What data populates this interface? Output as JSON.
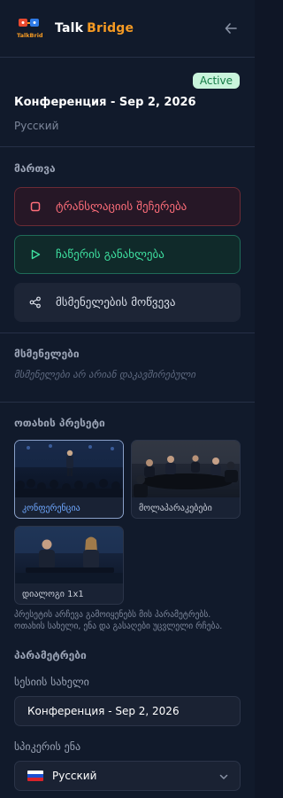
{
  "app": {
    "brand_part1": "Talk",
    "brand_part2": "Bridge",
    "logo_text": "TalkBridge"
  },
  "session": {
    "status_badge": "Active",
    "title": "Конференция - Sep 2, 2026",
    "language": "Русский"
  },
  "controls": {
    "section_label": "მართვა",
    "stop_label": "ტრანსლაციის შეჩერება",
    "resume_label": "ჩაწერის განახლება",
    "invite_label": "მსმენელების მოწვევა"
  },
  "listeners": {
    "section_label": "მსმენელები",
    "empty_text": "მსმენელები არ არიან დაკავშირებული"
  },
  "presets": {
    "section_label": "ოთახის პრესეტი",
    "items": [
      {
        "label": "კონფერენცია",
        "selected": true
      },
      {
        "label": "მოლაპარაკებები",
        "selected": false
      },
      {
        "label": "დიალოგი 1x1",
        "selected": false
      }
    ],
    "hint": "პრესეტის არჩევა გამოიყენებს მის პარამეტრებს. ოთახის სახელი, ენა და გასაღები უცვლელი რჩება."
  },
  "params": {
    "section_label": "პარამეტრები",
    "session_name_label": "სესიის სახელი",
    "session_name_value": "Конференция - Sep 2, 2026",
    "speaker_lang_label": "სპიკერის ენა",
    "speaker_lang_value": "Русский"
  },
  "colors": {
    "accent": "#f59a23",
    "active_badge_bg": "#c9f4dc",
    "stop_red": "#ff6e7a",
    "resume_green": "#3ee0a0"
  }
}
